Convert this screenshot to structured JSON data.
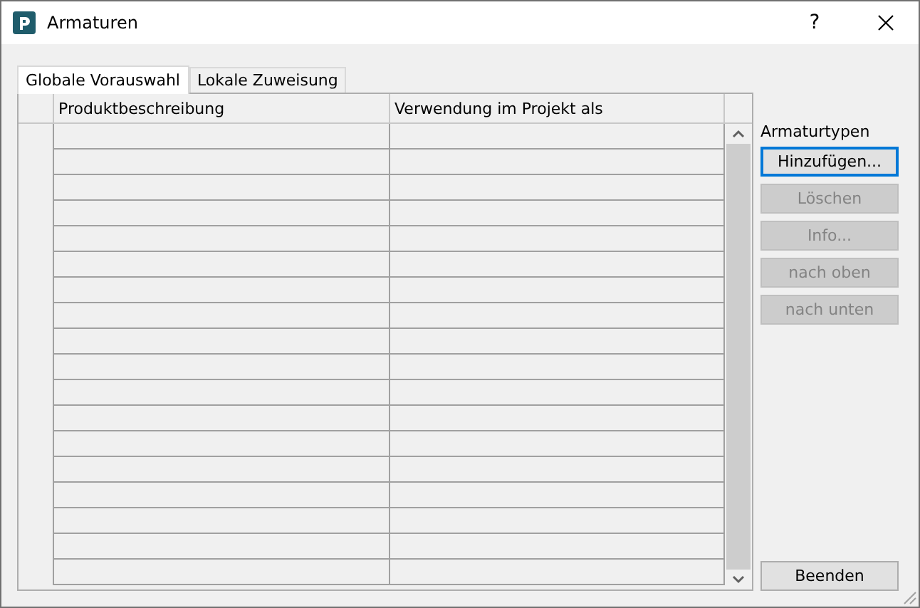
{
  "window": {
    "title": "Armaturen",
    "help": "?"
  },
  "tabs": [
    {
      "label": "Globale Vorauswahl",
      "selected": true
    },
    {
      "label": "Lokale Zuweisung",
      "selected": false
    }
  ],
  "table": {
    "columns": [
      "Produktbeschreibung",
      "Verwendung im Projekt als"
    ]
  },
  "side_panel": {
    "label": "Armaturtypen",
    "buttons": [
      {
        "label": "Hinzufügen...",
        "disabled": false,
        "focused": true
      },
      {
        "label": "Löschen",
        "disabled": true,
        "focused": false
      },
      {
        "label": "Info...",
        "disabled": true,
        "focused": false
      },
      {
        "label": "nach oben",
        "disabled": true,
        "focused": false
      },
      {
        "label": "nach unten",
        "disabled": true,
        "focused": false
      }
    ],
    "close_button": {
      "label": "Beenden",
      "disabled": false,
      "focused": false
    }
  }
}
